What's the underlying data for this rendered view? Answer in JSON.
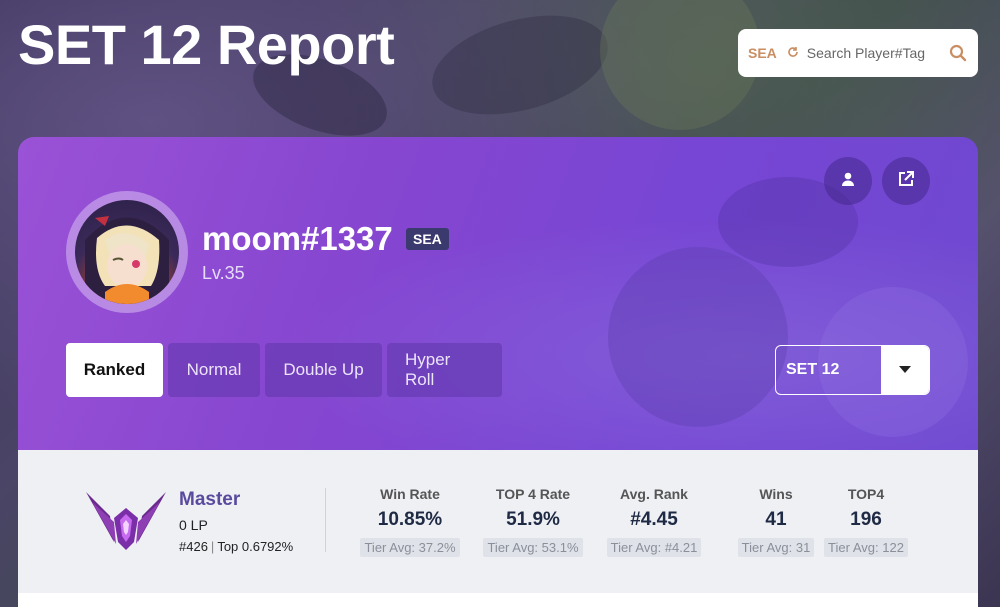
{
  "page": {
    "title": "SET 12 Report"
  },
  "search": {
    "region": "SEA",
    "placeholder": "Search Player#Tag"
  },
  "profile": {
    "name": "moom#1337",
    "region_badge": "SEA",
    "level": "Lv.35"
  },
  "mode_tabs": [
    {
      "label": "Ranked",
      "active": true
    },
    {
      "label": "Normal",
      "active": false
    },
    {
      "label": "Double Up",
      "active": false
    },
    {
      "label": "Hyper Roll",
      "active": false
    }
  ],
  "set_select": {
    "value": "SET 12"
  },
  "tier": {
    "name": "Master",
    "lp": "0 LP",
    "rank": "#426",
    "top": "Top 0.6792%"
  },
  "stats": [
    {
      "label": "Win Rate",
      "value": "10.85%",
      "avg": "Tier Avg: 37.2%"
    },
    {
      "label": "TOP 4 Rate",
      "value": "51.9%",
      "avg": "Tier Avg: 53.1%"
    },
    {
      "label": "Avg. Rank",
      "value": "#4.45",
      "avg": "Tier Avg: #4.21"
    },
    {
      "label": "Wins",
      "value": "41",
      "avg": "Tier Avg: 31"
    },
    {
      "label": "TOP4",
      "value": "196",
      "avg": "Tier Avg: 122"
    }
  ],
  "icons": {
    "search": "search-icon",
    "refresh": "refresh-icon",
    "profile": "user-icon",
    "share": "external-link-icon",
    "dropdown": "caret-down-icon",
    "emblem": "master-emblem-icon"
  },
  "colors": {
    "accent_purple": "#8646d0",
    "search_orange": "#c98e62",
    "tier_purple": "#5a4a9e",
    "badge_navy": "#3a3a6e"
  }
}
